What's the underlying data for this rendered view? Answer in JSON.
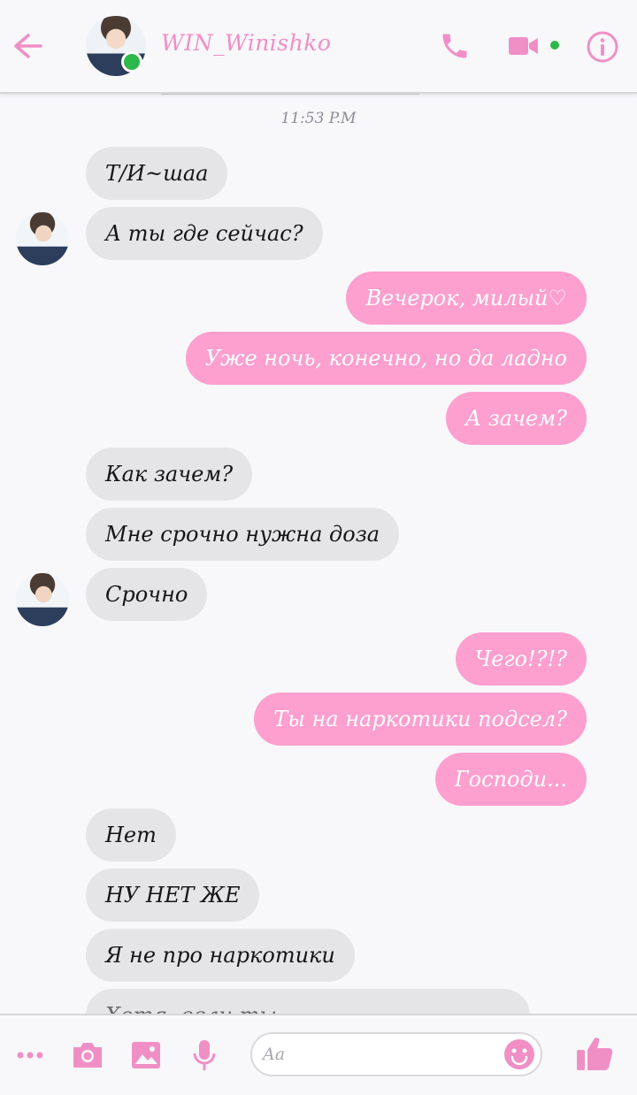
{
  "header": {
    "contact_name": "WIN_Winishko",
    "online": true,
    "icons": [
      "back-arrow-icon",
      "phone-icon",
      "video-camera-icon",
      "info-icon"
    ]
  },
  "timestamp": "11:53 P.M",
  "messages": [
    {
      "side": "in",
      "text": "Т/И~шаа"
    },
    {
      "side": "in",
      "text": "А ты где сейчас?"
    },
    {
      "side": "out",
      "text": "Вечерок, милый♡"
    },
    {
      "side": "out",
      "text": "Уже ночь, конечно, но да ладно"
    },
    {
      "side": "out",
      "text": "А зачем?"
    },
    {
      "side": "in",
      "text": "Как зачем?"
    },
    {
      "side": "in",
      "text": "Мне срочно нужна доза"
    },
    {
      "side": "in",
      "text": "Срочно"
    },
    {
      "side": "out",
      "text": "Чего!?!?"
    },
    {
      "side": "out",
      "text": "Ты на наркотики подсел?"
    },
    {
      "side": "out",
      "text": "Господи..."
    },
    {
      "side": "in",
      "text": "Нет"
    },
    {
      "side": "in",
      "text": "НУ НЕТ ЖЕ"
    },
    {
      "side": "in",
      "text": "Я не про наркотики"
    },
    {
      "side": "in",
      "text": "Хотя, если ты..."
    }
  ],
  "composer": {
    "placeholder": "Aa",
    "icons": [
      "more-icon",
      "camera-icon",
      "image-icon",
      "microphone-icon",
      "emoji-icon",
      "thumbs-up-icon"
    ]
  },
  "colors": {
    "accent": "#f08fc5",
    "outgoing_bubble": "#fd9fcf",
    "incoming_bubble": "#e5e4e7",
    "online": "#2db84b"
  }
}
